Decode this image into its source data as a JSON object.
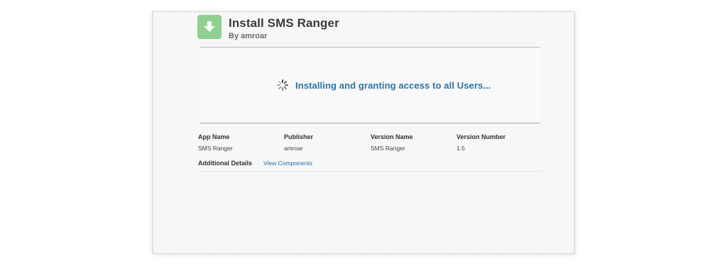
{
  "header": {
    "title": "Install SMS Ranger",
    "subtitle": "By amroar",
    "icon": "download-arrow-icon",
    "icon_color": "#8ed18f"
  },
  "progress": {
    "status_text": "Installing and granting access to all Users...",
    "status_color": "#2a73ac",
    "icon": "loading-spinner-icon"
  },
  "details": {
    "columns": [
      {
        "label": "App Name",
        "value": "SMS Ranger"
      },
      {
        "label": "Publisher",
        "value": "amroar"
      },
      {
        "label": "Version Name",
        "value": "SMS Ranger"
      },
      {
        "label": "Version Number",
        "value": "1.5"
      }
    ],
    "additional_label": "Additional Details",
    "view_components_link": "View Components",
    "link_color": "#1f6cab"
  }
}
